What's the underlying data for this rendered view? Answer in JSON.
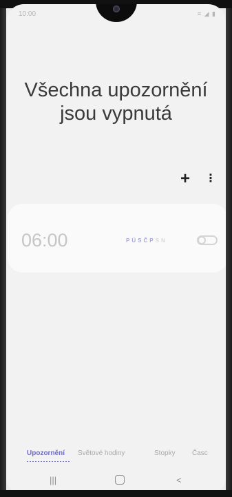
{
  "status_bar": {
    "time": "10:00",
    "icons": "≡ ◢ ▮"
  },
  "headline": {
    "line1": "Všechna upozornění",
    "line2": "jsou vypnutá"
  },
  "toolbar": {
    "add_icon": "+",
    "more_icon": "⋮"
  },
  "alarm": {
    "time": "06:00",
    "days": [
      {
        "label": "P",
        "active": true
      },
      {
        "label": "Ú",
        "active": true
      },
      {
        "label": "S",
        "active": true
      },
      {
        "label": "Č",
        "active": true
      },
      {
        "label": "P",
        "active": true
      },
      {
        "label": "S",
        "active": false
      },
      {
        "label": "N",
        "active": false
      }
    ],
    "enabled": false
  },
  "tabs": [
    {
      "label": "Upozornění",
      "active": true
    },
    {
      "label": "Světové hodiny",
      "active": false
    },
    {
      "label": "Stopky",
      "active": false
    },
    {
      "label": "Časc",
      "active": false
    }
  ],
  "navbar": {
    "recents_icon": "|||",
    "back_icon": "<"
  },
  "colors": {
    "accent": "#6f6dbf",
    "day_active": "#a8a7d8",
    "day_inactive": "#d8d8d8",
    "background": "#f2f2f2",
    "card": "#fafafa"
  }
}
